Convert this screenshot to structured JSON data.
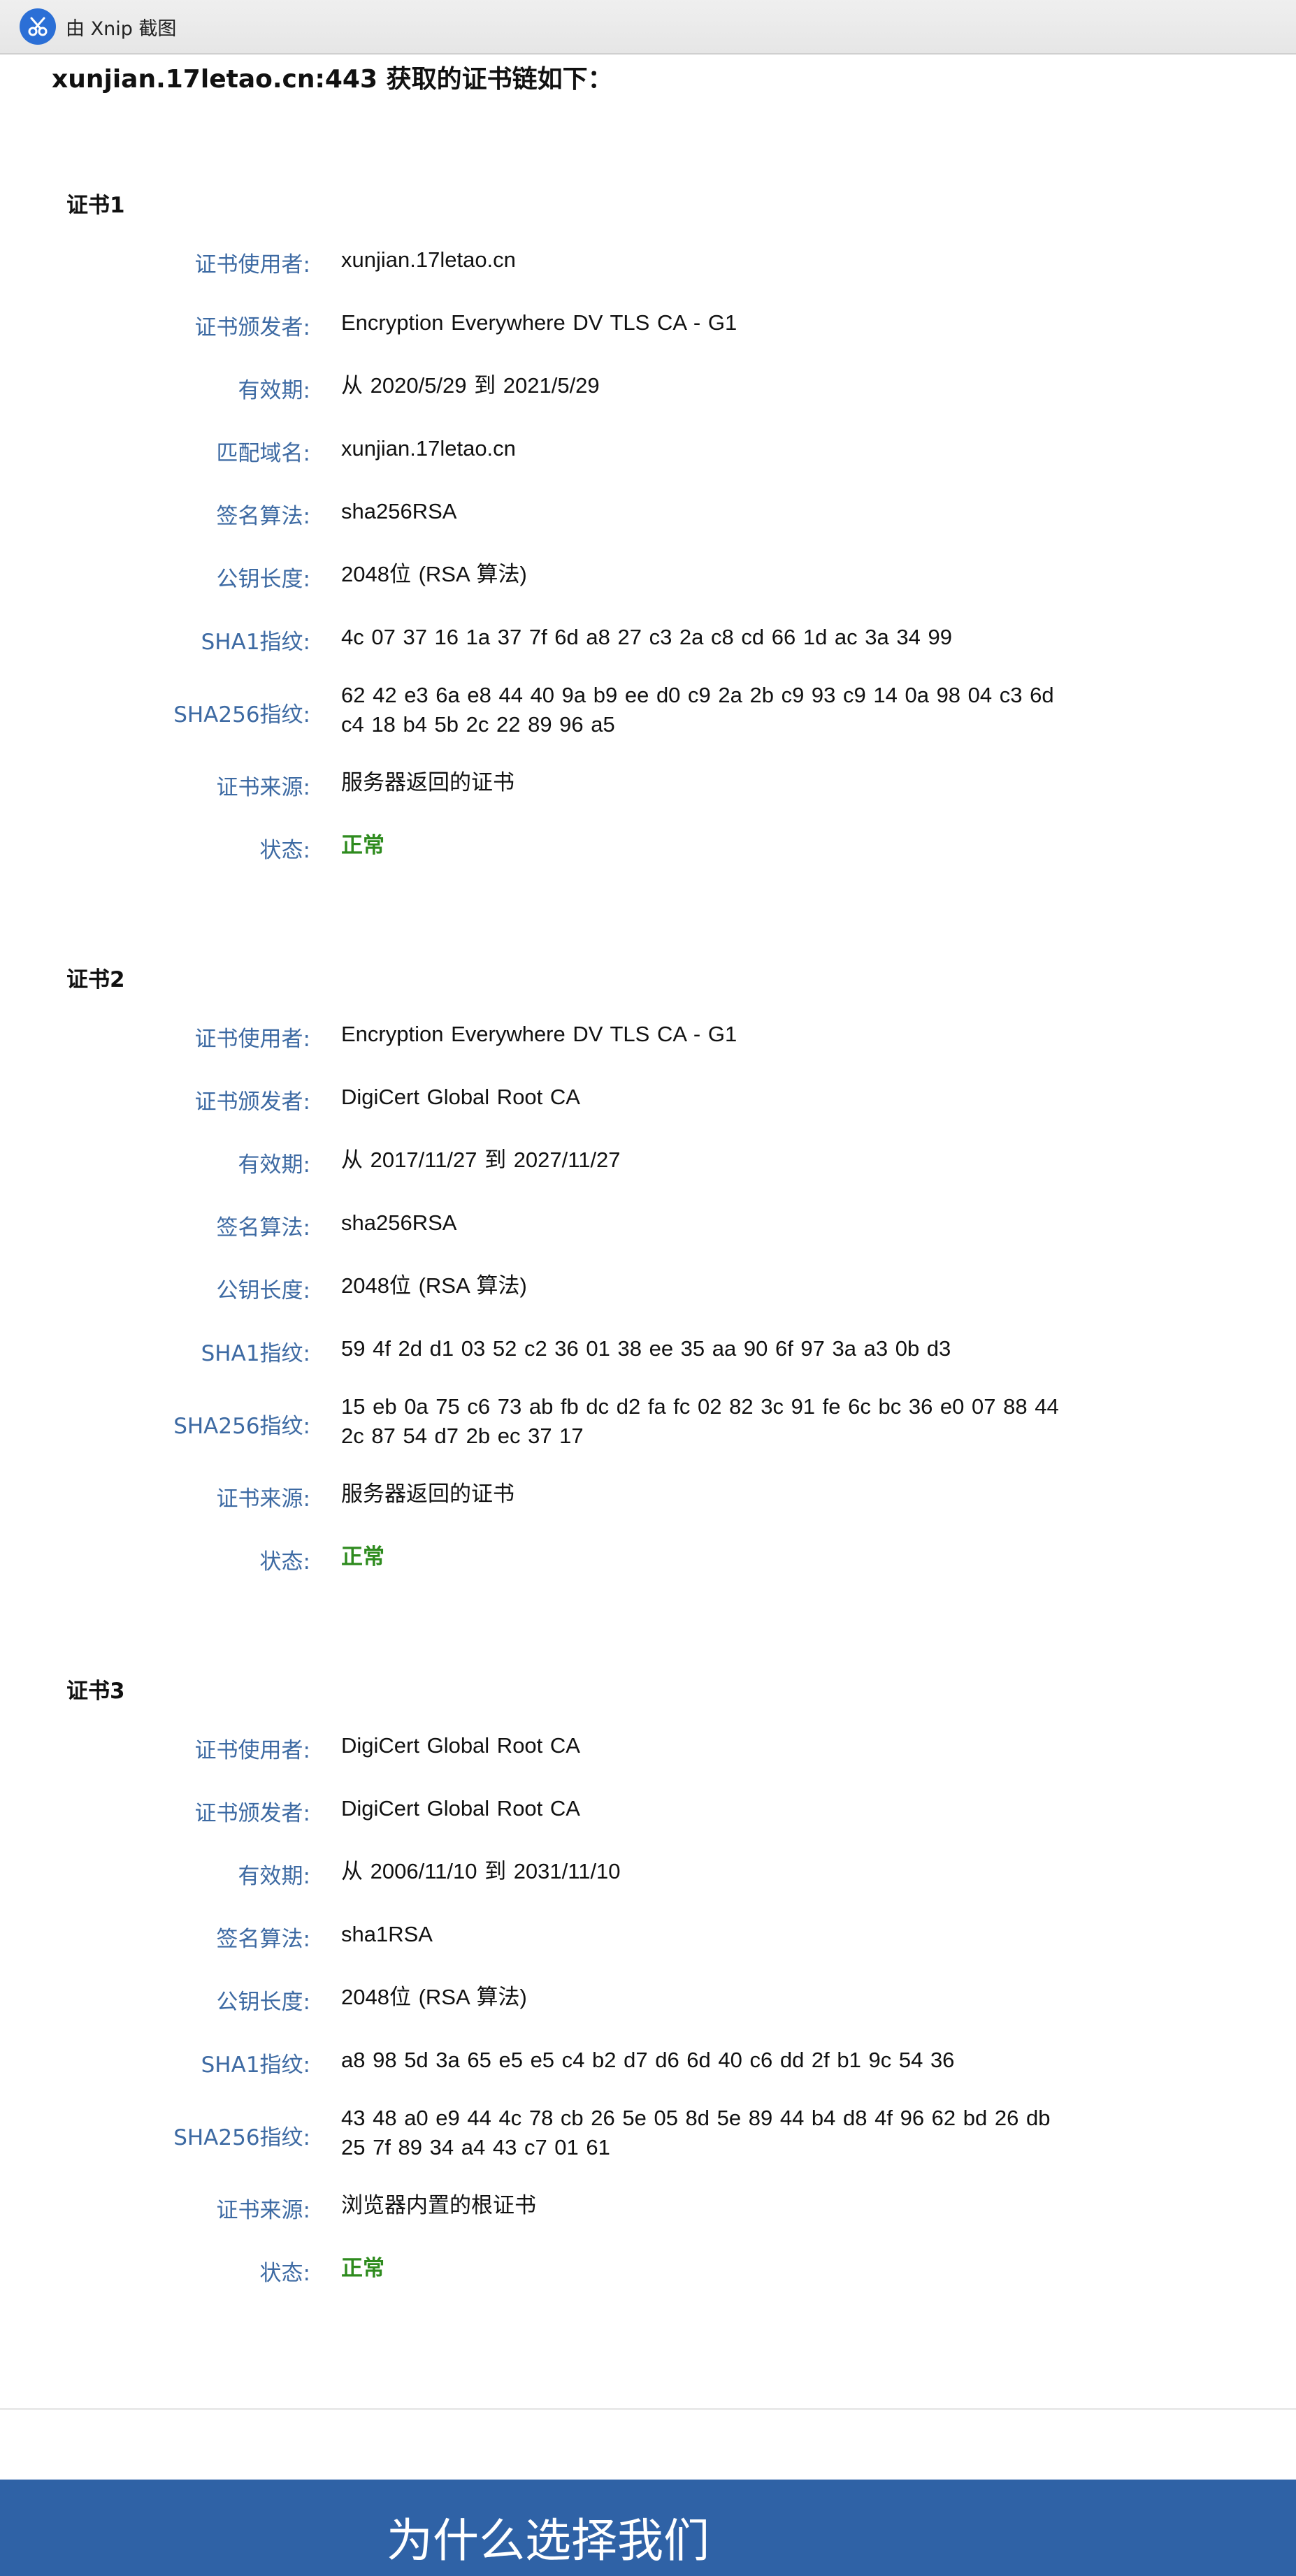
{
  "toolbar": {
    "label": "由 Xnip 截图",
    "logo_icon": "xnip-scissors-icon"
  },
  "page_title": "xunjian.17letao.cn:443 获取的证书链如下：",
  "certificates": [
    {
      "heading": "证书1",
      "fields": [
        {
          "label": "证书使用者:",
          "value": "xunjian.17letao.cn"
        },
        {
          "label": "证书颁发者:",
          "value": "Encryption Everywhere DV TLS CA - G1"
        },
        {
          "label": "有效期:",
          "value": "从 2020/5/29 到 2021/5/29"
        },
        {
          "label": "匹配域名:",
          "value": "xunjian.17letao.cn"
        },
        {
          "label": "签名算法:",
          "value": "sha256RSA"
        },
        {
          "label": "公钥长度:",
          "value": "2048位 (RSA 算法)"
        },
        {
          "label": "SHA1指纹:",
          "value": "4c 07 37 16 1a 37 7f 6d a8 27 c3 2a c8 cd 66 1d ac 3a 34 99"
        },
        {
          "label": "SHA256指纹:",
          "value": "62 42 e3 6a e8 44 40 9a b9 ee d0 c9 2a 2b c9 93 c9 14 0a 98 04 c3 6d c4 18 b4 5b 2c 22 89 96 a5"
        },
        {
          "label": "证书来源:",
          "value": "服务器返回的证书"
        },
        {
          "label": "状态:",
          "value": "正常"
        }
      ]
    },
    {
      "heading": "证书2",
      "fields": [
        {
          "label": "证书使用者:",
          "value": "Encryption Everywhere DV TLS CA - G1"
        },
        {
          "label": "证书颁发者:",
          "value": "DigiCert Global Root CA"
        },
        {
          "label": "有效期:",
          "value": "从 2017/11/27 到 2027/11/27"
        },
        {
          "label": "签名算法:",
          "value": "sha256RSA"
        },
        {
          "label": "公钥长度:",
          "value": "2048位 (RSA 算法)"
        },
        {
          "label": "SHA1指纹:",
          "value": "59 4f 2d d1 03 52 c2 36 01 38 ee 35 aa 90 6f 97 3a a3 0b d3"
        },
        {
          "label": "SHA256指纹:",
          "value": "15 eb 0a 75 c6 73 ab fb dc d2 fa fc 02 82 3c 91 fe 6c bc 36 e0 07 88 44 2c 87 54 d7 2b ec 37 17"
        },
        {
          "label": "证书来源:",
          "value": "服务器返回的证书"
        },
        {
          "label": "状态:",
          "value": "正常"
        }
      ]
    },
    {
      "heading": "证书3",
      "fields": [
        {
          "label": "证书使用者:",
          "value": "DigiCert Global Root CA"
        },
        {
          "label": "证书颁发者:",
          "value": "DigiCert Global Root CA"
        },
        {
          "label": "有效期:",
          "value": "从 2006/11/10 到 2031/11/10"
        },
        {
          "label": "签名算法:",
          "value": "sha1RSA"
        },
        {
          "label": "公钥长度:",
          "value": "2048位 (RSA 算法)"
        },
        {
          "label": "SHA1指纹:",
          "value": "a8 98 5d 3a 65 e5 e5 c4 b2 d7 d6 6d 40 c6 dd 2f b1 9c 54 36"
        },
        {
          "label": "SHA256指纹:",
          "value": "43 48 a0 e9 44 4c 78 cb 26 5e 05 8d 5e 89 44 b4 d8 4f 96 62 bd 26 db 25 7f 89 34 a4 43 c7 01 61"
        },
        {
          "label": "证书来源:",
          "value": "浏览器内置的根证书"
        },
        {
          "label": "状态:",
          "value": "正常"
        }
      ]
    }
  ],
  "banner": {
    "text": "为什么选择我们"
  },
  "colors": {
    "label": "#3d6aa3",
    "status_ok": "#2e8b1e",
    "banner": "#2f62a6"
  }
}
